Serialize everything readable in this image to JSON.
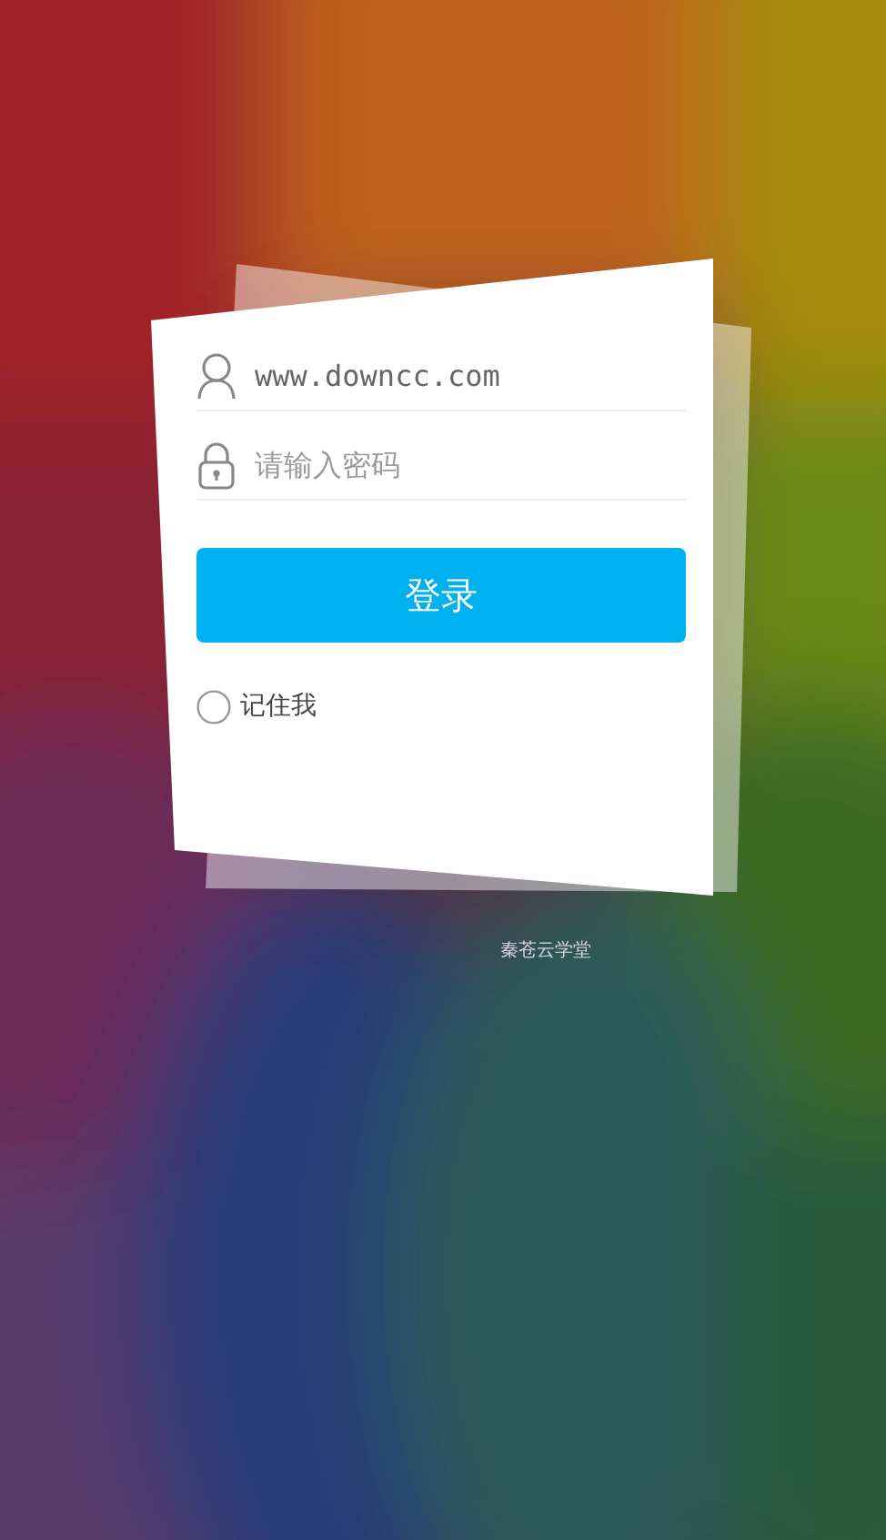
{
  "login": {
    "username": {
      "value": "www.downcc.com"
    },
    "password": {
      "placeholder": "请输入密码"
    },
    "submit": "登录",
    "remember": {
      "label": "记住我",
      "checked": false
    }
  },
  "footer": "秦苍云学堂"
}
